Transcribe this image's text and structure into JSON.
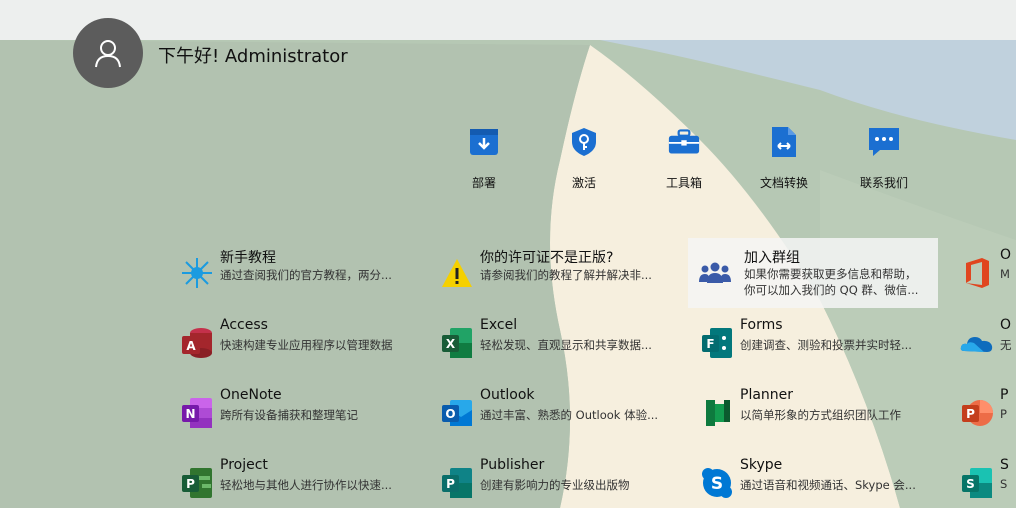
{
  "header": {
    "greeting": "下午好! Administrator"
  },
  "quick_actions": [
    {
      "label": "部署",
      "icon": "deploy-icon"
    },
    {
      "label": "激活",
      "icon": "activate-key-icon"
    },
    {
      "label": "工具箱",
      "icon": "toolbox-icon"
    },
    {
      "label": "文档转换",
      "icon": "document-convert-icon"
    },
    {
      "label": "联系我们",
      "icon": "chat-icon"
    }
  ],
  "tiles": [
    {
      "title": "新手教程",
      "desc": "通过查阅我们的官方教程，两分...",
      "icon": "sparkle-icon"
    },
    {
      "title": "你的许可证不是正版?",
      "desc": "请参阅我们的教程了解并解决非...",
      "icon": "warning-icon"
    },
    {
      "title": "加入群组",
      "desc": "如果你需要获取更多信息和帮助，",
      "desc2": "你可以加入我们的 QQ 群、微信...",
      "icon": "group-icon"
    },
    {
      "title": "O",
      "desc": "M",
      "icon": "office-icon"
    },
    {
      "title": "Access",
      "desc": "快速构建专业应用程序以管理数据",
      "icon": "access-icon"
    },
    {
      "title": "Excel",
      "desc": "轻松发现、直观显示和共享数据...",
      "icon": "excel-icon"
    },
    {
      "title": "Forms",
      "desc": "创建调查、测验和投票并实时轻...",
      "icon": "forms-icon"
    },
    {
      "title": "O",
      "desc": "无",
      "icon": "onedrive-icon"
    },
    {
      "title": "OneNote",
      "desc": "跨所有设备捕获和整理笔记",
      "icon": "onenote-icon"
    },
    {
      "title": "Outlook",
      "desc": "通过丰富、熟悉的 Outlook 体验...",
      "icon": "outlook-icon"
    },
    {
      "title": "Planner",
      "desc": "以简单形象的方式组织团队工作",
      "icon": "planner-icon"
    },
    {
      "title": "P",
      "desc": "P",
      "icon": "powerpoint-icon"
    },
    {
      "title": "Project",
      "desc": "轻松地与其他人进行协作以快速...",
      "icon": "project-icon"
    },
    {
      "title": "Publisher",
      "desc": "创建有影响力的专业级出版物",
      "icon": "publisher-icon"
    },
    {
      "title": "Skype",
      "desc": "通过语音和视频通话、Skype 会...",
      "icon": "skype-icon"
    },
    {
      "title": "S",
      "desc": "S",
      "icon": "sway-icon"
    }
  ]
}
